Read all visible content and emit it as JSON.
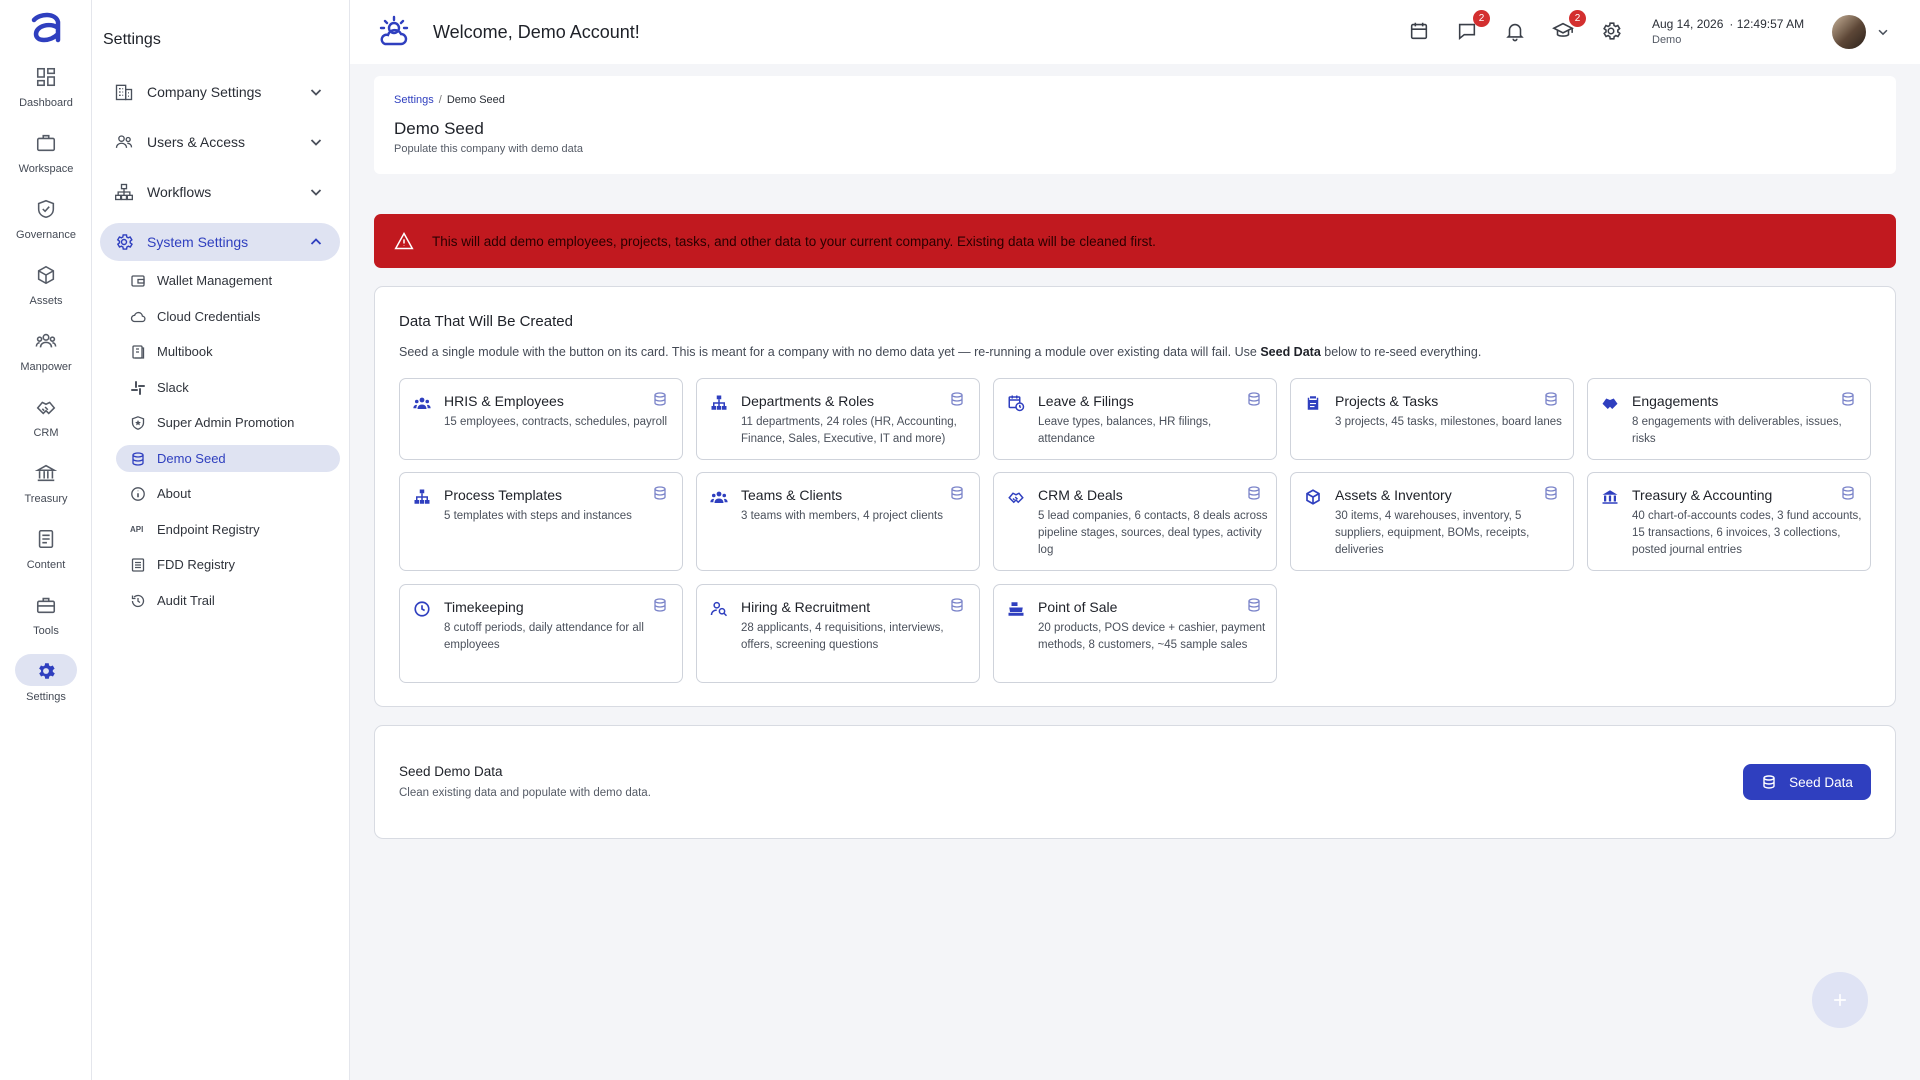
{
  "rail": {
    "items": [
      {
        "label": "Dashboard",
        "icon": "dashboard-icon"
      },
      {
        "label": "Workspace",
        "icon": "briefcase-icon"
      },
      {
        "label": "Governance",
        "icon": "shield-check-icon"
      },
      {
        "label": "Assets",
        "icon": "cube-icon"
      },
      {
        "label": "Manpower",
        "icon": "people-icon"
      },
      {
        "label": "CRM",
        "icon": "handshake-icon"
      },
      {
        "label": "Treasury",
        "icon": "bank-icon"
      },
      {
        "label": "Content",
        "icon": "document-icon"
      },
      {
        "label": "Tools",
        "icon": "toolbox-icon"
      },
      {
        "label": "Settings",
        "icon": "gear-icon"
      }
    ]
  },
  "settings_nav": {
    "title": "Settings",
    "groups": [
      {
        "label": "Company Settings",
        "icon": "building-icon"
      },
      {
        "label": "Users & Access",
        "icon": "users-icon"
      },
      {
        "label": "Workflows",
        "icon": "sitemap-icon"
      },
      {
        "label": "System Settings",
        "icon": "gear-icon"
      }
    ],
    "system_items": [
      {
        "label": "Wallet Management",
        "icon": "wallet-icon"
      },
      {
        "label": "Cloud Credentials",
        "icon": "cloud-icon"
      },
      {
        "label": "Multibook",
        "icon": "book-icon"
      },
      {
        "label": "Slack",
        "icon": "slack-icon"
      },
      {
        "label": "Super Admin Promotion",
        "icon": "shield-star-icon"
      },
      {
        "label": "Demo Seed",
        "icon": "database-icon"
      },
      {
        "label": "About",
        "icon": "info-icon"
      },
      {
        "label": "Endpoint Registry",
        "icon": "api-icon",
        "icon_text": "API"
      },
      {
        "label": "FDD Registry",
        "icon": "registry-icon"
      },
      {
        "label": "Audit Trail",
        "icon": "history-icon"
      }
    ]
  },
  "header": {
    "welcome": "Welcome, Demo Account!",
    "messages_badge": "2",
    "learning_badge": "2",
    "date": "Aug 14, 2026",
    "time": "· 12:49:57 AM",
    "company": "Demo"
  },
  "page": {
    "breadcrumb_root": "Settings",
    "breadcrumb_sep": "/",
    "breadcrumb_current": "Demo Seed",
    "title": "Demo Seed",
    "subtitle": "Populate this company with demo data"
  },
  "alert": {
    "text": "This will add demo employees, projects, tasks, and other data to your current company. Existing data will be cleaned first."
  },
  "data_card": {
    "title": "Data That Will Be Created",
    "desc_before": "Seed a single module with the button on its card. This is meant for a company with no demo data yet — re-running a module over existing data will fail. Use ",
    "desc_bold": "Seed Data",
    "desc_after": " below to re-seed everything.",
    "modules": [
      {
        "title": "HRIS & Employees",
        "desc": "15 employees, contracts, schedules, payroll",
        "icon": "people-icon"
      },
      {
        "title": "Departments & Roles",
        "desc": "11 departments, 24 roles (HR, Accounting, Finance, Sales, Executive, IT and more)",
        "icon": "sitemap-icon"
      },
      {
        "title": "Leave & Filings",
        "desc": "Leave types, balances, HR filings, attendance",
        "icon": "calendar-clock-icon"
      },
      {
        "title": "Projects & Tasks",
        "desc": "3 projects, 45 tasks, milestones, board lanes",
        "icon": "clipboard-icon"
      },
      {
        "title": "Engagements",
        "desc": "8 engagements with deliverables, issues, risks",
        "icon": "handshake-icon"
      },
      {
        "title": "Process Templates",
        "desc": "5 templates with steps and instances",
        "icon": "sitemap-icon"
      },
      {
        "title": "Teams & Clients",
        "desc": "3 teams with members, 4 project clients",
        "icon": "people-icon"
      },
      {
        "title": "CRM & Deals",
        "desc": "5 lead companies, 6 contacts, 8 deals across pipeline stages, sources, deal types, activity log",
        "icon": "handshake-icon"
      },
      {
        "title": "Assets & Inventory",
        "desc": "30 items, 4 warehouses, inventory, 5 suppliers, equipment, BOMs, receipts, deliveries",
        "icon": "cube-icon"
      },
      {
        "title": "Treasury & Accounting",
        "desc": "40 chart-of-accounts codes, 3 fund accounts, 15 transactions, 6 invoices, 3 collections, posted journal entries",
        "icon": "bank-icon"
      },
      {
        "title": "Timekeeping",
        "desc": "8 cutoff periods, daily attendance for all employees",
        "icon": "clock-icon"
      },
      {
        "title": "Hiring & Recruitment",
        "desc": "28 applicants, 4 requisitions, interviews, offers, screening questions",
        "icon": "person-search-icon"
      },
      {
        "title": "Point of Sale",
        "desc": "20 products, POS device + cashier, payment methods, 8 customers, ~45 sample sales",
        "icon": "register-icon"
      }
    ]
  },
  "seed_card": {
    "title": "Seed Demo Data",
    "subtitle": "Clean existing data and populate with demo data.",
    "button": "Seed Data"
  },
  "colors": {
    "accent": "#2f3fbf",
    "alert": "#c1191f",
    "badge": "#d32f2f",
    "active_bg": "#dfe3f2"
  }
}
